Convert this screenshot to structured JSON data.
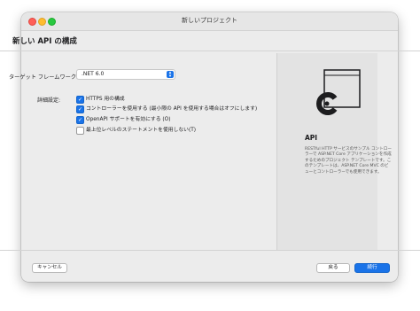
{
  "window": {
    "title": "新しいプロジェクト"
  },
  "page": {
    "title": "新しい API の構成"
  },
  "framework": {
    "label": "ターゲット フレームワーク:",
    "value": ".NET 6.0"
  },
  "advanced": {
    "label": "詳細設定:",
    "options": [
      {
        "label": "HTTPS 用の構成",
        "checked": true
      },
      {
        "label": "コントローラーを使用する (最小限の API を使用する場合はオフにします)",
        "checked": true
      },
      {
        "label": "OpenAPI サポートを有効にする (O)",
        "checked": true
      },
      {
        "label": "最上位レベルのステートメントを使用しない(T)",
        "checked": false
      }
    ]
  },
  "side": {
    "name": "API",
    "description": "RESTful HTTP サービスのサンプル コントローラーで ASP.NET Core アプリケーションを作成するためのプロジェクト テンプレートです。このテンプレートは、ASP.NET Core MVC のビューとコントローラーでも使用できます。",
    "icon": "api-template-icon"
  },
  "footer": {
    "cancel": "キャンセル",
    "back": "戻る",
    "next": "続行"
  },
  "colors": {
    "accent": "#1a73e8"
  }
}
